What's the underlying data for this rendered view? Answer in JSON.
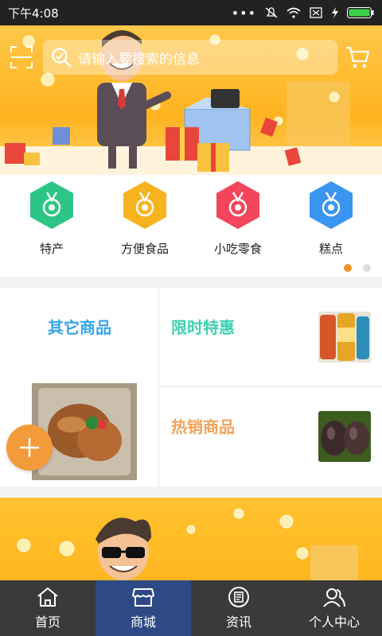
{
  "status_bar": {
    "time": "下午4:08"
  },
  "search": {
    "placeholder": "请输入要搜索的信息"
  },
  "categories": [
    {
      "label": "特产",
      "color": "#2cc585",
      "icon": "medal-icon"
    },
    {
      "label": "方便食品",
      "color": "#f7b31e",
      "icon": "medal-icon"
    },
    {
      "label": "小吃零食",
      "color": "#f3455c",
      "icon": "medal-icon"
    },
    {
      "label": "糕点",
      "color": "#3a95f0",
      "icon": "medal-icon"
    }
  ],
  "pager": {
    "active_index": 0,
    "count": 2
  },
  "products": {
    "left": {
      "title": "其它商品",
      "color": "#36a6e8"
    },
    "right_top": {
      "title": "限时特惠",
      "color": "#3fd0b2"
    },
    "right_bottom": {
      "title": "热销商品",
      "color": "#f3a35a"
    }
  },
  "bottom_nav": {
    "items": [
      {
        "label": "首页",
        "icon": "home-icon"
      },
      {
        "label": "商城",
        "icon": "store-icon",
        "active": true
      },
      {
        "label": "资讯",
        "icon": "news-icon"
      },
      {
        "label": "个人中心",
        "icon": "user-icon"
      }
    ]
  },
  "colors": {
    "accent": "#2d4a86",
    "fab": "#f39a3b"
  }
}
